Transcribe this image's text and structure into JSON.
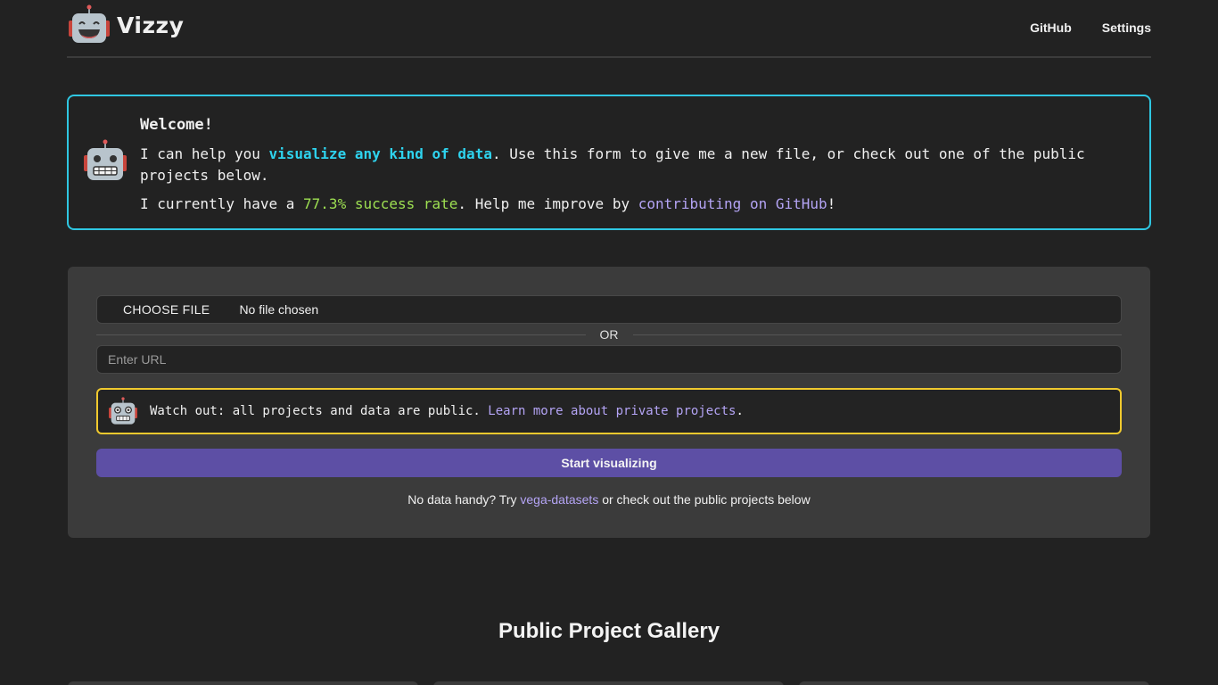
{
  "header": {
    "app_name": "Vizzy",
    "nav": [
      "GitHub",
      "Settings"
    ]
  },
  "welcome": {
    "title": "Welcome!",
    "line1_pre": "I can help you ",
    "line1_highlight": "visualize any kind of data",
    "line1_post": ". Use this form to give me a new file, or check out one of the public projects below.",
    "line2_pre": "I currently have a ",
    "line2_rate": "77.3% success rate",
    "line2_mid": ". Help me improve by ",
    "line2_link": "contributing on GitHub",
    "line2_post": "!"
  },
  "form": {
    "choose_file_label": "CHOOSE FILE",
    "file_status": "No file chosen",
    "or_label": "OR",
    "url_placeholder": "Enter URL",
    "warning_pre": "Watch out: all projects and data are public. ",
    "warning_link": "Learn more about private projects",
    "warning_post": ".",
    "start_button": "Start visualizing",
    "hint_pre": "No data handy? Try ",
    "hint_link": "vega-datasets",
    "hint_post": " or check out the public projects below"
  },
  "gallery": {
    "title": "Public Project Gallery"
  },
  "colors": {
    "background": "#222222",
    "welcome_border": "#2fc7e2",
    "warning_border": "#f0c92e",
    "accent_button": "#5d4fa5",
    "success_rate": "#9ee052",
    "link": "#b4a4f5"
  },
  "icons": [
    "robot-logo-icon",
    "robot-icon",
    "robot-warning-icon"
  ]
}
